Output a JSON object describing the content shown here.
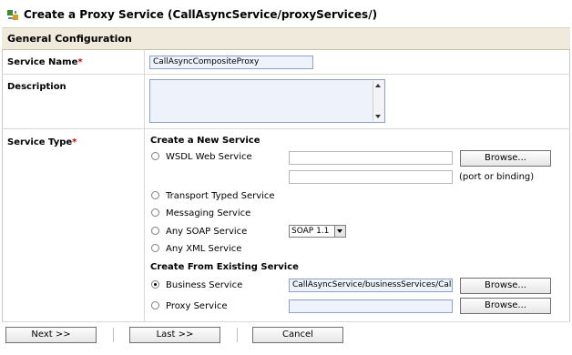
{
  "header": {
    "title": "Create a Proxy Service (CallAsyncService/proxyServices/)"
  },
  "section": {
    "title": "General Configuration"
  },
  "service_name": {
    "label": "Service Name",
    "required_mark": "*",
    "value": "CallAsyncCompositeProxy"
  },
  "description": {
    "label": "Description",
    "value": ""
  },
  "service_type": {
    "label": "Service Type",
    "required_mark": "*",
    "create_new_heading": "Create a New Service",
    "wsdl_label": "WSDL Web Service",
    "wsdl_value": "",
    "wsdl_port_value": "",
    "browse_label": "Browse...",
    "port_binding_hint": "(port or binding)",
    "transport_typed_label": "Transport Typed Service",
    "messaging_label": "Messaging Service",
    "any_soap_label": "Any SOAP Service",
    "soap_version": "SOAP 1.1",
    "any_xml_label": "Any XML Service",
    "create_existing_heading": "Create From Existing Service",
    "business_service_label": "Business Service",
    "business_service_value": "CallAsyncService/businessServices/CallAs",
    "proxy_service_label": "Proxy Service",
    "proxy_service_value": "",
    "selected_option": "Business Service"
  },
  "footer": {
    "next_label": "Next >>",
    "last_label": "Last >>",
    "cancel_label": "Cancel"
  }
}
